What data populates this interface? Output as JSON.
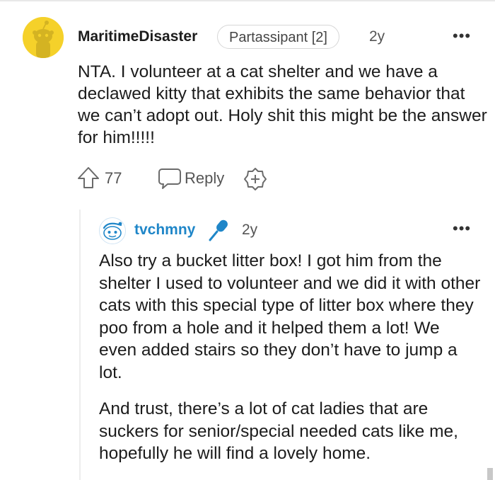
{
  "parent_comment": {
    "username": "MaritimeDisaster",
    "flair": "Partassipant [2]",
    "age": "2y",
    "more": "•••",
    "body": "NTA. I volunteer at a cat shelter and we have a declawed kitty that exhibits the same behavior that we can’t adopt out. Holy shit this might be the answer for him!!!!!",
    "upvotes": "77",
    "reply_label": "Reply",
    "avatar_color": "#f5d12a"
  },
  "reply_comment": {
    "username": "tvchmny",
    "age": "2y",
    "more": "•••",
    "username_color": "#1f86c8",
    "paragraphs": [
      "Also try a bucket litter box! I got him from the shelter I used to volunteer and we did it with other cats with this special type of litter box where they poo from a hole and it helped them a lot! We even added stairs so they don’t have to jump a lot.",
      "And trust, there’s a lot of cat ladies that are suckers for senior/special needed cats like me, hopefully he will find a lovely home."
    ]
  },
  "icons": {
    "upvote": "upvote-arrow-icon",
    "reply": "speech-bubble-icon",
    "award": "add-award-icon",
    "mic": "microphone-icon"
  }
}
